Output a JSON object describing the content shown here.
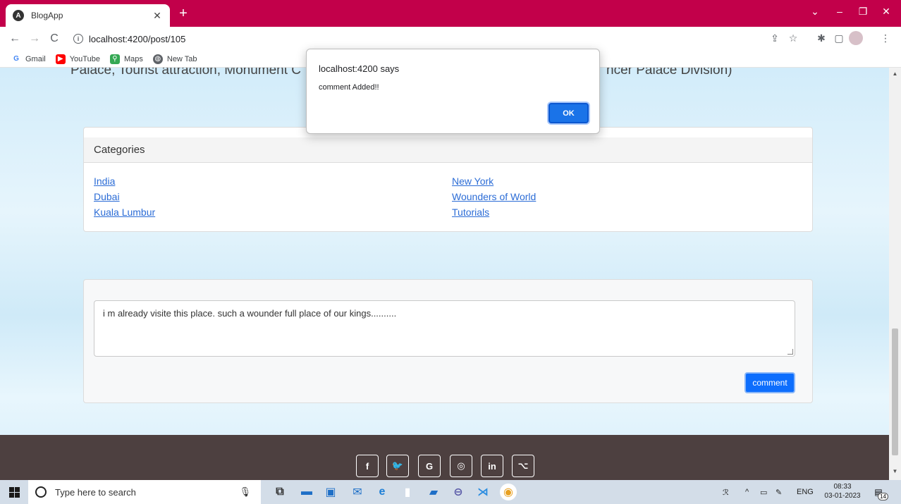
{
  "browser": {
    "tab_title": "BlogApp",
    "tab_favicon": "angular-icon",
    "url": "localhost:4200/post/105",
    "accent_color": "#c2004a"
  },
  "bookmarks": [
    {
      "label": "Gmail",
      "icon": "google-icon"
    },
    {
      "label": "YouTube",
      "icon": "youtube-icon"
    },
    {
      "label": "Maps",
      "icon": "maps-icon"
    },
    {
      "label": "New Tab",
      "icon": "globe-icon"
    }
  ],
  "page": {
    "cutoff_text_left": "Palace, Tourist attraction, Monument C",
    "cutoff_text_right": "ncer Palace Division)",
    "categories": {
      "header": "Categories",
      "left": [
        "India",
        "Dubai",
        "Kuala Lumbur"
      ],
      "right": [
        "New York",
        "Wounders of World",
        "Tutorials"
      ]
    },
    "comment": {
      "text": "i m already visite this place. such a wounder full place of our kings..........",
      "button_label": "comment"
    },
    "footer_social": [
      "f",
      "t",
      "G",
      "o",
      "in",
      "gh"
    ]
  },
  "dialog": {
    "title": "localhost:4200 says",
    "message": "comment Added!!",
    "ok_label": "OK"
  },
  "taskbar": {
    "search_placeholder": "Type here to search",
    "language": "ENG",
    "time": "08:33",
    "date": "03-01-2023",
    "notification_count": "14"
  }
}
